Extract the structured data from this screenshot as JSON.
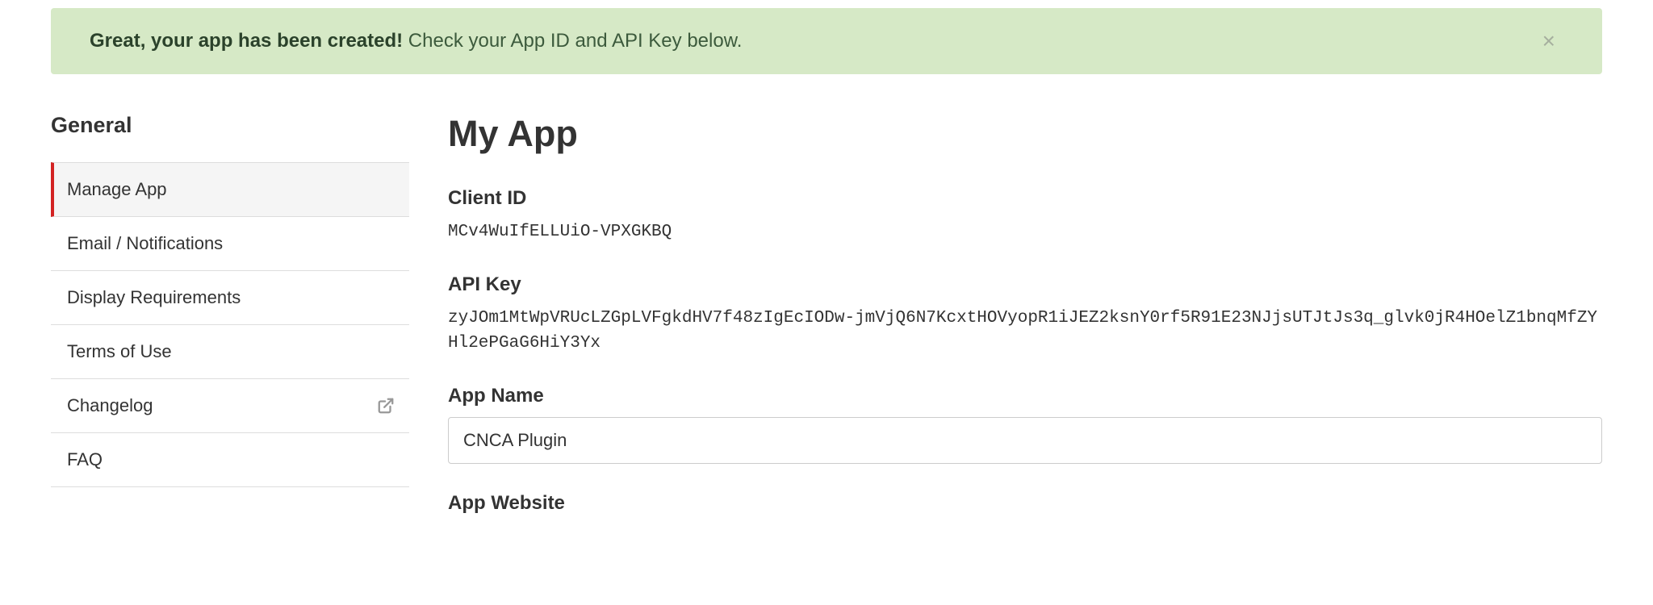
{
  "alert": {
    "bold": "Great, your app has been created!",
    "text": " Check your App ID and API Key below."
  },
  "sidebar": {
    "heading": "General",
    "items": [
      {
        "label": "Manage App",
        "active": true,
        "external": false
      },
      {
        "label": "Email / Notifications",
        "active": false,
        "external": false
      },
      {
        "label": "Display Requirements",
        "active": false,
        "external": false
      },
      {
        "label": "Terms of Use",
        "active": false,
        "external": false
      },
      {
        "label": "Changelog",
        "active": false,
        "external": true
      },
      {
        "label": "FAQ",
        "active": false,
        "external": false
      }
    ]
  },
  "main": {
    "title": "My App",
    "client_id_label": "Client ID",
    "client_id_value": "MCv4WuIfELLUiO-VPXGKBQ",
    "api_key_label": "API Key",
    "api_key_value": "zyJOm1MtWpVRUcLZGpLVFgkdHV7f48zIgEcIODw-jmVjQ6N7KcxtHOVyopR1iJEZ2ksnY0rf5R91E23NJjsUTJtJs3q_glvk0jR4HOelZ1bnqMfZYHl2ePGaG6HiY3Yx",
    "app_name_label": "App Name",
    "app_name_value": "CNCA Plugin",
    "app_website_label": "App Website"
  }
}
